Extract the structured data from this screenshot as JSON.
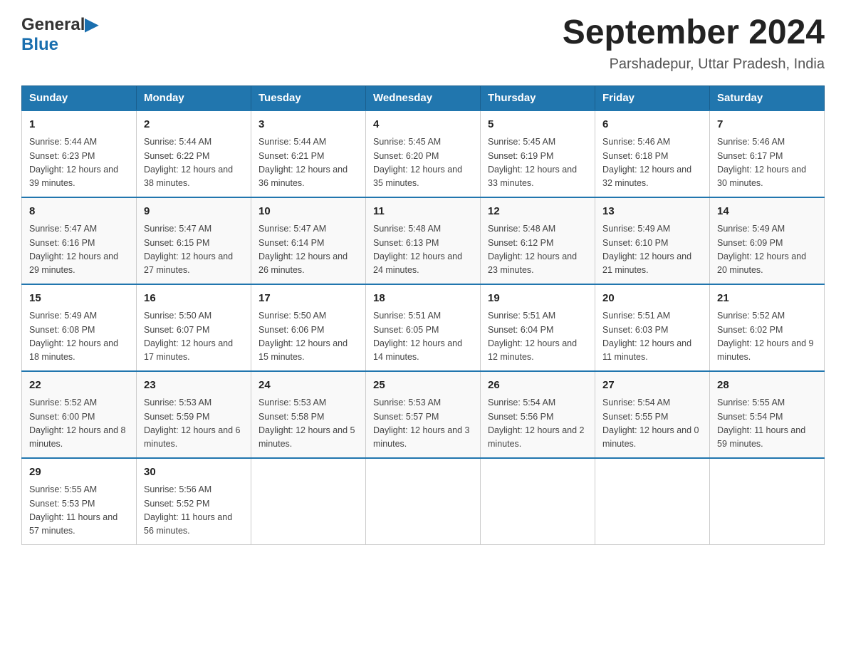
{
  "header": {
    "logo_general": "General",
    "logo_blue": "Blue",
    "month_title": "September 2024",
    "location": "Parshadepur, Uttar Pradesh, India"
  },
  "days_of_week": [
    "Sunday",
    "Monday",
    "Tuesday",
    "Wednesday",
    "Thursday",
    "Friday",
    "Saturday"
  ],
  "weeks": [
    [
      {
        "day": "1",
        "sunrise": "5:44 AM",
        "sunset": "6:23 PM",
        "daylight": "12 hours and 39 minutes."
      },
      {
        "day": "2",
        "sunrise": "5:44 AM",
        "sunset": "6:22 PM",
        "daylight": "12 hours and 38 minutes."
      },
      {
        "day": "3",
        "sunrise": "5:44 AM",
        "sunset": "6:21 PM",
        "daylight": "12 hours and 36 minutes."
      },
      {
        "day": "4",
        "sunrise": "5:45 AM",
        "sunset": "6:20 PM",
        "daylight": "12 hours and 35 minutes."
      },
      {
        "day": "5",
        "sunrise": "5:45 AM",
        "sunset": "6:19 PM",
        "daylight": "12 hours and 33 minutes."
      },
      {
        "day": "6",
        "sunrise": "5:46 AM",
        "sunset": "6:18 PM",
        "daylight": "12 hours and 32 minutes."
      },
      {
        "day": "7",
        "sunrise": "5:46 AM",
        "sunset": "6:17 PM",
        "daylight": "12 hours and 30 minutes."
      }
    ],
    [
      {
        "day": "8",
        "sunrise": "5:47 AM",
        "sunset": "6:16 PM",
        "daylight": "12 hours and 29 minutes."
      },
      {
        "day": "9",
        "sunrise": "5:47 AM",
        "sunset": "6:15 PM",
        "daylight": "12 hours and 27 minutes."
      },
      {
        "day": "10",
        "sunrise": "5:47 AM",
        "sunset": "6:14 PM",
        "daylight": "12 hours and 26 minutes."
      },
      {
        "day": "11",
        "sunrise": "5:48 AM",
        "sunset": "6:13 PM",
        "daylight": "12 hours and 24 minutes."
      },
      {
        "day": "12",
        "sunrise": "5:48 AM",
        "sunset": "6:12 PM",
        "daylight": "12 hours and 23 minutes."
      },
      {
        "day": "13",
        "sunrise": "5:49 AM",
        "sunset": "6:10 PM",
        "daylight": "12 hours and 21 minutes."
      },
      {
        "day": "14",
        "sunrise": "5:49 AM",
        "sunset": "6:09 PM",
        "daylight": "12 hours and 20 minutes."
      }
    ],
    [
      {
        "day": "15",
        "sunrise": "5:49 AM",
        "sunset": "6:08 PM",
        "daylight": "12 hours and 18 minutes."
      },
      {
        "day": "16",
        "sunrise": "5:50 AM",
        "sunset": "6:07 PM",
        "daylight": "12 hours and 17 minutes."
      },
      {
        "day": "17",
        "sunrise": "5:50 AM",
        "sunset": "6:06 PM",
        "daylight": "12 hours and 15 minutes."
      },
      {
        "day": "18",
        "sunrise": "5:51 AM",
        "sunset": "6:05 PM",
        "daylight": "12 hours and 14 minutes."
      },
      {
        "day": "19",
        "sunrise": "5:51 AM",
        "sunset": "6:04 PM",
        "daylight": "12 hours and 12 minutes."
      },
      {
        "day": "20",
        "sunrise": "5:51 AM",
        "sunset": "6:03 PM",
        "daylight": "12 hours and 11 minutes."
      },
      {
        "day": "21",
        "sunrise": "5:52 AM",
        "sunset": "6:02 PM",
        "daylight": "12 hours and 9 minutes."
      }
    ],
    [
      {
        "day": "22",
        "sunrise": "5:52 AM",
        "sunset": "6:00 PM",
        "daylight": "12 hours and 8 minutes."
      },
      {
        "day": "23",
        "sunrise": "5:53 AM",
        "sunset": "5:59 PM",
        "daylight": "12 hours and 6 minutes."
      },
      {
        "day": "24",
        "sunrise": "5:53 AM",
        "sunset": "5:58 PM",
        "daylight": "12 hours and 5 minutes."
      },
      {
        "day": "25",
        "sunrise": "5:53 AM",
        "sunset": "5:57 PM",
        "daylight": "12 hours and 3 minutes."
      },
      {
        "day": "26",
        "sunrise": "5:54 AM",
        "sunset": "5:56 PM",
        "daylight": "12 hours and 2 minutes."
      },
      {
        "day": "27",
        "sunrise": "5:54 AM",
        "sunset": "5:55 PM",
        "daylight": "12 hours and 0 minutes."
      },
      {
        "day": "28",
        "sunrise": "5:55 AM",
        "sunset": "5:54 PM",
        "daylight": "11 hours and 59 minutes."
      }
    ],
    [
      {
        "day": "29",
        "sunrise": "5:55 AM",
        "sunset": "5:53 PM",
        "daylight": "11 hours and 57 minutes."
      },
      {
        "day": "30",
        "sunrise": "5:56 AM",
        "sunset": "5:52 PM",
        "daylight": "11 hours and 56 minutes."
      },
      null,
      null,
      null,
      null,
      null
    ]
  ]
}
